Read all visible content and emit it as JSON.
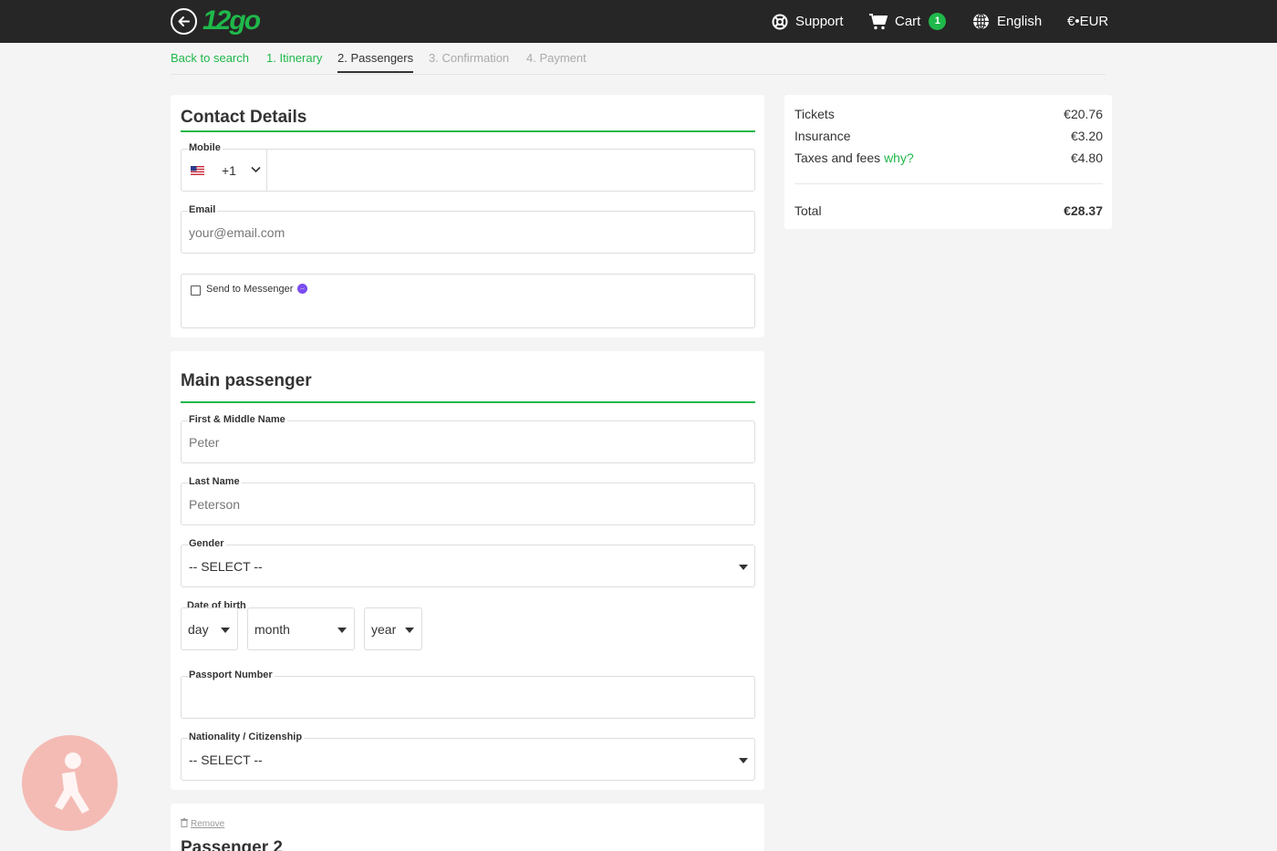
{
  "header": {
    "logo": "12go",
    "support": "Support",
    "cart": "Cart",
    "cart_count": "1",
    "language": "English",
    "currency": "€•EUR"
  },
  "steps": {
    "back": "Back to search",
    "itinerary": "1. Itinerary",
    "passengers": "2. Passengers",
    "confirmation": "3. Confirmation",
    "payment": "4. Payment"
  },
  "contact": {
    "title": "Contact Details",
    "mobile_label": "Mobile",
    "mobile_code": "+1",
    "email_label": "Email",
    "email_placeholder": "your@email.com",
    "messenger_label": "Send to Messenger"
  },
  "main_passenger": {
    "title": "Main passenger",
    "first_label": "First & Middle Name",
    "first_placeholder": "Peter",
    "last_label": "Last Name",
    "last_placeholder": "Peterson",
    "gender_label": "Gender",
    "gender_value": "-- SELECT --",
    "dob_label": "Date of birth",
    "dob_day": "day",
    "dob_month": "month",
    "dob_year": "year",
    "passport_label": "Passport Number",
    "nationality_label": "Nationality / Citizenship",
    "nationality_value": "-- SELECT --"
  },
  "passenger2": {
    "remove": "Remove",
    "title": "Passenger 2"
  },
  "summary": {
    "tickets_label": "Tickets",
    "tickets_value": "€20.76",
    "insurance_label": "Insurance",
    "insurance_value": "€3.20",
    "taxes_label": "Taxes and fees",
    "taxes_link": "why?",
    "taxes_value": "€4.80",
    "total_label": "Total",
    "total_value": "€28.37"
  },
  "colors": {
    "accent": "#1fb84a",
    "topbar": "#262626"
  }
}
